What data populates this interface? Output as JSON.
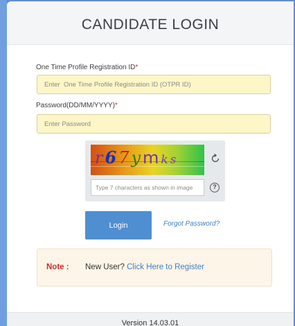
{
  "header": {
    "title": "CANDIDATE LOGIN"
  },
  "form": {
    "otpr_label": "One Time Profile Registration ID",
    "otpr_required": "*",
    "otpr_placeholder": "Enter  One Time Profile Registration ID (OTPR ID)",
    "password_label": "Password(DD/MM/YYYY)",
    "password_required": "*",
    "password_placeholder": "Enter Password"
  },
  "captcha": {
    "chars": [
      "r",
      "6",
      "7",
      "y",
      "m",
      "k",
      "s"
    ],
    "input_placeholder": "Type 7 characters as shown in image",
    "refresh_icon": "refresh-icon",
    "help_icon": "question-circle-icon",
    "help_symbol": "?"
  },
  "actions": {
    "login_label": "Login",
    "forgot_label": "Forgot Password?"
  },
  "note": {
    "label": "Note :",
    "text": "New User? ",
    "link": "Click Here to Register"
  },
  "footer": {
    "version": "Version 14.03.01"
  },
  "colors": {
    "accent": "#4f8fd1",
    "input_bg": "#fdf6c7",
    "required": "#d62b2b",
    "link": "#3f7fc6",
    "background": "#5b8ed6"
  }
}
